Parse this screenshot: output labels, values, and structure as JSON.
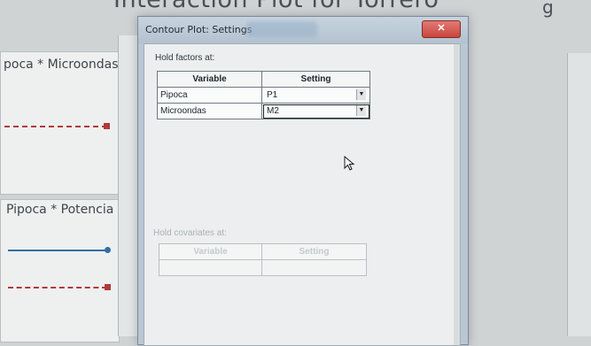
{
  "background": {
    "plot_title": "Interaction Plot for Torrero",
    "right_fragment": "g",
    "panel_top_label": "poca * Microondas",
    "panel_bottom_label": "Pipoca * Potencia"
  },
  "dialog": {
    "title": "Contour Plot: Settings",
    "title_suffix_blurred": "Means",
    "close_glyph": "✕",
    "factors_label": "Hold factors at:",
    "factors_headers": [
      "Variable",
      "Setting"
    ],
    "factors_rows": [
      {
        "variable": "Pipoca",
        "setting": "P1"
      },
      {
        "variable": "Microondas",
        "setting": "M2"
      }
    ],
    "covariates_label": "Hold covariates at:",
    "covariates_headers": [
      "Variable",
      "Setting"
    ]
  },
  "colors": {
    "accent_red": "#b2393a",
    "accent_blue": "#2f6fa8"
  }
}
